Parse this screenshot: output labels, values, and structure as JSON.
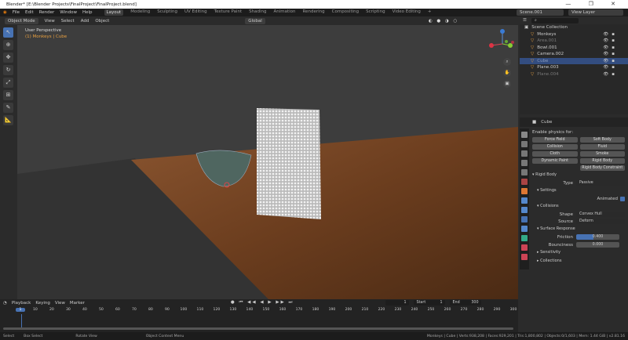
{
  "window": {
    "title": "Blender* [E:\\Blender Projects\\FinalProject\\FinalProject.blend]",
    "controls": "— ❐ ✕"
  },
  "menu": [
    "File",
    "Edit",
    "Render",
    "Window",
    "Help"
  ],
  "workspaces": [
    "Layout",
    "Modeling",
    "Sculpting",
    "UV Editing",
    "Texture Paint",
    "Shading",
    "Animation",
    "Rendering",
    "Compositing",
    "Scripting",
    "Video Editing",
    "+"
  ],
  "scene": "Scene.001",
  "view_layer": "View Layer",
  "viewport": {
    "mode": "Object Mode",
    "menus": [
      "View",
      "Select",
      "Add",
      "Object"
    ],
    "orientation": "Global",
    "overlay_title": "User Perspective",
    "overlay_sub": "(1) Monkeys | Cube"
  },
  "outliner": {
    "root": "Scene Collection",
    "items": [
      {
        "name": "Monkeys",
        "color": "#cccccc",
        "selected": false
      },
      {
        "name": "Area.001",
        "color": "#777777",
        "selected": false
      },
      {
        "name": "Bowl.001",
        "color": "#cccccc",
        "selected": false
      },
      {
        "name": "Camera.002",
        "color": "#cccccc",
        "selected": false
      },
      {
        "name": "Cube",
        "color": "#8899bb",
        "selected": true
      },
      {
        "name": "Plane.003",
        "color": "#cccccc",
        "selected": false
      },
      {
        "name": "Plane.004",
        "color": "#777777",
        "selected": false
      }
    ]
  },
  "properties": {
    "object": "Cube",
    "enable_label": "Enable physics for:",
    "physics_buttons": [
      "Force Field",
      "Soft Body",
      "Collision",
      "Fluid",
      "Cloth",
      "Smoke",
      "Dynamic Paint",
      "Rigid Body",
      "",
      "Rigid Body Constraint"
    ],
    "rigid_body": "Rigid Body",
    "type_label": "Type",
    "type_value": "Passive",
    "settings": "Settings",
    "animated": "Animated",
    "collisions": "Collisions",
    "shape_label": "Shape",
    "shape_value": "Convex Hull",
    "source_label": "Source",
    "source_value": "Deform",
    "surface": "Surface Response",
    "friction_label": "Friction",
    "friction_value": "0.400",
    "friction_fraction": 0.4,
    "bounciness_label": "Bounciness",
    "bounciness_value": "0.000",
    "sensitivity": "Sensitivity",
    "collections": "Collections"
  },
  "timeline": {
    "menus": [
      "Playback",
      "Keying",
      "View",
      "Marker"
    ],
    "current": "1",
    "start_label": "Start",
    "start": "1",
    "end_label": "End",
    "end": "300",
    "ticks": [
      "1",
      "10",
      "20",
      "30",
      "40",
      "50",
      "60",
      "70",
      "80",
      "90",
      "100",
      "110",
      "120",
      "130",
      "140",
      "150",
      "160",
      "170",
      "180",
      "190",
      "200",
      "210",
      "220",
      "230",
      "240",
      "250",
      "260",
      "270",
      "280",
      "290",
      "300"
    ]
  },
  "status": {
    "select": "Select",
    "box": "Box Select",
    "rotate": "Rotate View",
    "context": "Object Context Menu",
    "stats": "Monkeys | Cube | Verts:938,208 | Faces:929,201 | Tris:1,800,802 | Objects:0/1,603 | Mem: 1.44 GiB | v2.81.16"
  }
}
